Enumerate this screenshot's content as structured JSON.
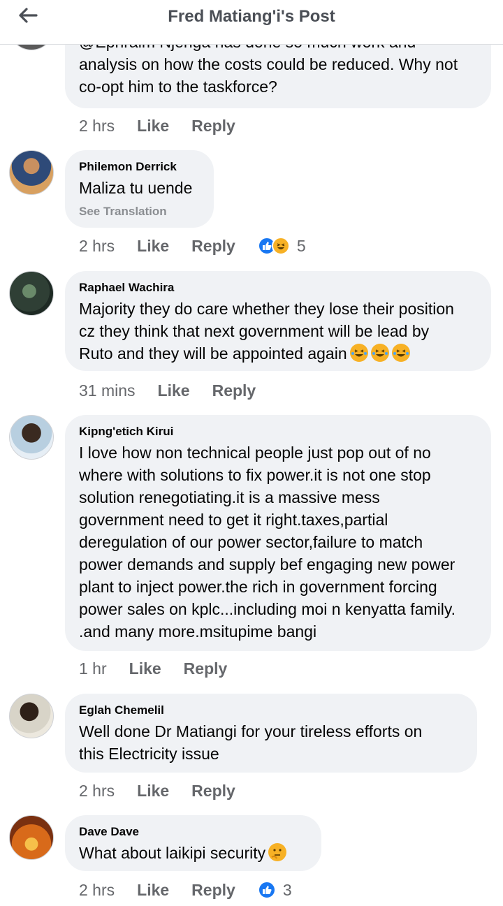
{
  "header": {
    "title": "Fred Matiang'i's Post"
  },
  "comments": [
    {
      "author": "",
      "text": "@Ephraim Njenga has done so much work and\nanalysis on how the costs could be reduced. Why not\nco-opt him to the taskforce?",
      "time": "2 hrs",
      "like": "Like",
      "reply": "Reply"
    },
    {
      "author": "Philemon Derrick",
      "text": "Maliza tu uende",
      "see_translation": "See Translation",
      "time": "2 hrs",
      "like": "Like",
      "reply": "Reply",
      "reaction_count": "5",
      "reactions": [
        "like-icon",
        "haha-icon"
      ]
    },
    {
      "author": "Raphael Wachira",
      "text": "Majority they do care whether they lose their position\ncz they think that next government will be lead by\nRuto and they will be appointed again",
      "emojis": [
        "tears-of-joy-emoji",
        "tears-of-joy-emoji",
        "tears-of-joy-emoji"
      ],
      "time": "31 mins",
      "like": "Like",
      "reply": "Reply"
    },
    {
      "author": "Kipng'etich Kirui",
      "text": "I love how non technical people just pop out of no\nwhere with solutions to fix power.it is not one stop\nsolution renegotiating.it is a massive mess\ngovernment need to get it right.taxes,partial\nderegulation of our power sector,failure to match\npower demands and supply bef engaging new power\nplant to inject power.the rich in government forcing\npower sales on kplc...including moi n kenyatta family.\n.and many more.msitupime bangi",
      "time": "1 hr",
      "like": "Like",
      "reply": "Reply"
    },
    {
      "author": "Eglah Chemelil",
      "text": "Well done  Dr Matiangi  for your  tireless  efforts  on\nthis Electricity  issue",
      "time": "2 hrs",
      "like": "Like",
      "reply": "Reply"
    },
    {
      "author": "Dave Dave",
      "text": "What about  laikipi security",
      "emojis": [
        "thinking-face-emoji"
      ],
      "time": "2 hrs",
      "like": "Like",
      "reply": "Reply",
      "reaction_count": "3",
      "reactions": [
        "like-icon"
      ]
    }
  ],
  "colors": {
    "bubble": "#f0f2f5",
    "meta_text": "#65676b",
    "like_blue": "#1877f2",
    "haha_yellow": "#f7b125"
  }
}
